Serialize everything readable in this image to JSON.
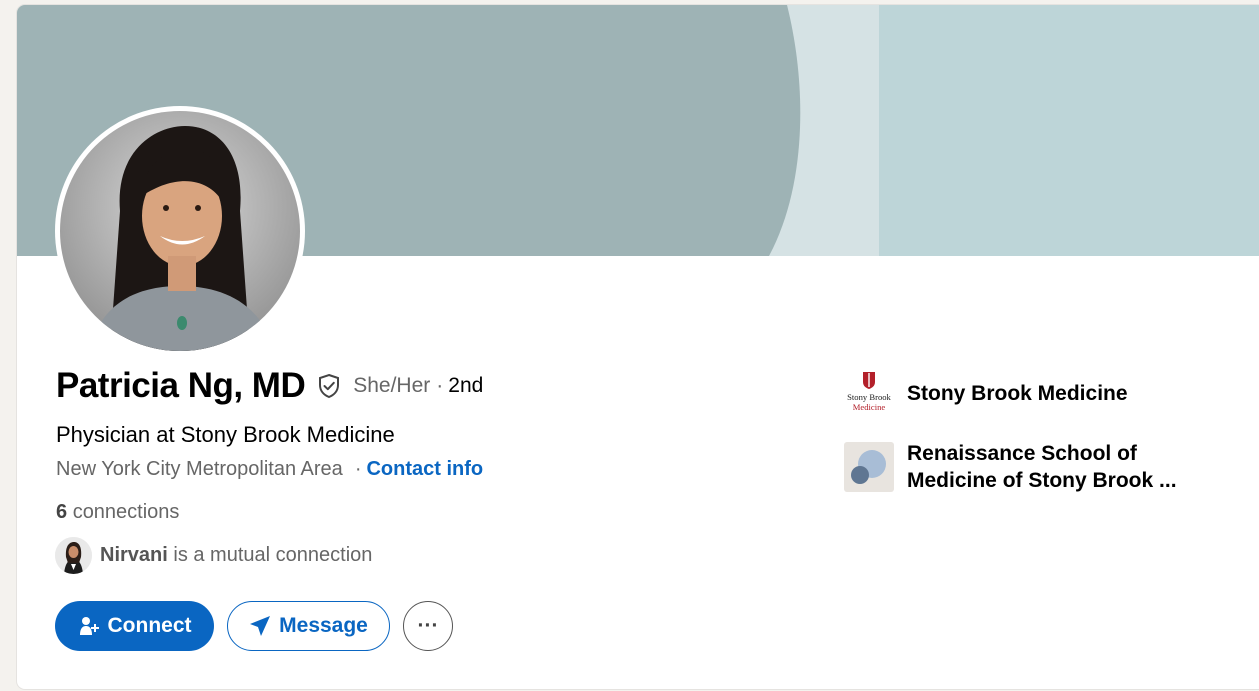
{
  "profile": {
    "name": "Patricia Ng, MD",
    "pronouns": "She/Her",
    "degree_separator": "·",
    "degree": "2nd",
    "headline": "Physician at Stony Brook Medicine",
    "location": "New York City Metropolitan Area",
    "location_separator": "·",
    "contact_info_label": "Contact info",
    "connections_count": "6",
    "connections_label": "connections",
    "mutual_name": "Nirvani",
    "mutual_suffix": "is a mutual connection"
  },
  "actions": {
    "connect_label": "Connect",
    "message_label": "Message",
    "more_label": "···"
  },
  "organizations": [
    {
      "name": "Stony Brook Medicine",
      "logo_line1": "Stony Brook",
      "logo_line2": "Medicine"
    },
    {
      "name": "Renaissance School of Medicine of Stony Brook ..."
    }
  ],
  "icons": {
    "verified": "shield-check-icon",
    "connect": "person-plus-icon",
    "message": "paper-plane-icon",
    "more": "ellipsis-icon"
  },
  "colors": {
    "brand_blue": "#0a66c2",
    "banner_main": "#9eb3b5",
    "banner_light": "#d5e2e4",
    "banner_right": "#bdd5d8",
    "muted_text": "#666666",
    "page_bg": "#f4f2ee"
  }
}
